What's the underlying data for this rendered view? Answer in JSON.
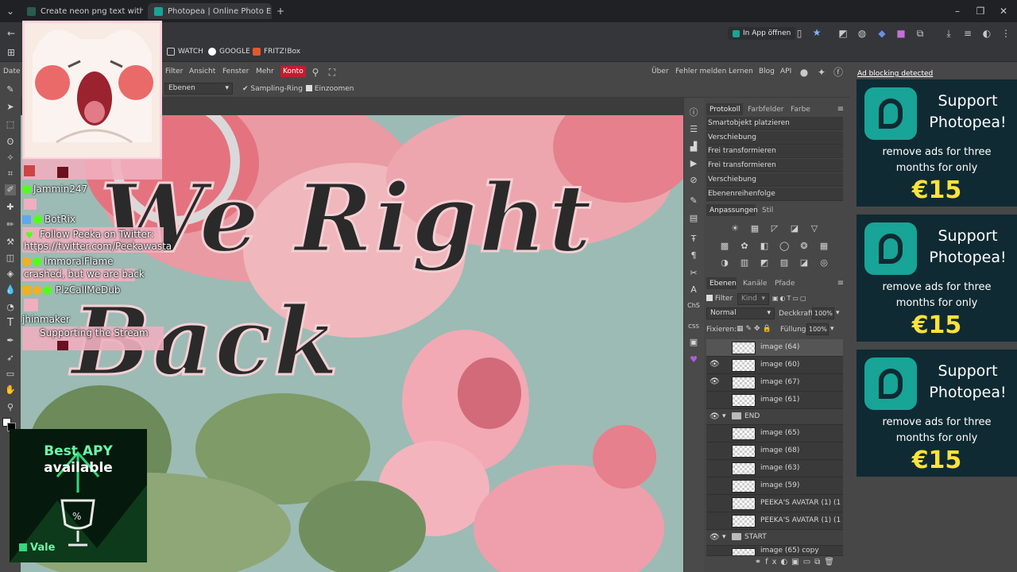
{
  "browser": {
    "tabs": [
      {
        "label": "Create neon png text with a tra",
        "active": false
      },
      {
        "label": "Photopea | Online Photo Editor",
        "active": true
      }
    ],
    "open_in_app": "In App öffnen",
    "bookmarks": [
      "WATCH",
      "GOOGLE",
      "FRITZ!Box"
    ],
    "menu_partial": "Date"
  },
  "photopea": {
    "menu": [
      "Filter",
      "Ansicht",
      "Fenster",
      "Mehr",
      "Konto"
    ],
    "menu_right": [
      "Über",
      "Fehler melden",
      "Lernen",
      "Blog",
      "API"
    ],
    "options": {
      "sample_select": "Ebenen",
      "sampling_ring": "Sampling-Ring",
      "zoom_in": "Einzoomen"
    },
    "history_tabs": [
      "Protokoll",
      "Farbfelder",
      "Farbe"
    ],
    "history": [
      "Smartobjekt platzieren",
      "Verschiebung",
      "Frei transformieren",
      "Frei transformieren",
      "Verschiebung",
      "Ebenenreihenfolge"
    ],
    "adjust_tabs": [
      "Anpassungen",
      "Stil"
    ],
    "layer_tabs": [
      "Ebenen",
      "Kanäle",
      "Pfade"
    ],
    "layers_filter": {
      "label": "Filter",
      "kind": "Kind"
    },
    "blend": "Normal",
    "opacity_label": "Deckkraft:",
    "opacity": "100%",
    "lock_label": "Fixieren:",
    "fill_label": "Füllung:",
    "fill": "100%",
    "ch_label": "ChS",
    "css_label": "CSS",
    "layers": [
      {
        "name": "image (64)",
        "visible": false,
        "folder": false
      },
      {
        "name": "image (60)",
        "visible": true,
        "folder": false
      },
      {
        "name": "image (67)",
        "visible": true,
        "folder": false
      },
      {
        "name": "image (61)",
        "visible": false,
        "folder": false
      },
      {
        "name": "END",
        "visible": true,
        "folder": true
      },
      {
        "name": "image (65)",
        "visible": false,
        "folder": false
      },
      {
        "name": "image (68)",
        "visible": false,
        "folder": false
      },
      {
        "name": "image (63)",
        "visible": false,
        "folder": false
      },
      {
        "name": "image (59)",
        "visible": false,
        "folder": false
      },
      {
        "name": "PEEKA'S AVATAR (1) (1",
        "visible": false,
        "folder": false
      },
      {
        "name": "PEEKA'S AVATAR (1) (1",
        "visible": false,
        "folder": false
      },
      {
        "name": "START",
        "visible": true,
        "folder": true
      },
      {
        "name": "image (65) copy",
        "visible": false,
        "folder": false
      }
    ]
  },
  "canvas": {
    "line1": "We Right",
    "line2": "Back"
  },
  "ads": {
    "notice": "Ad blocking detected",
    "title": "Support Photopea!",
    "subtitle": "remove ads for three months for only",
    "price": "€15"
  },
  "stream": {
    "chat": [
      {
        "text": "Jammin247"
      },
      {
        "text": "BotRix"
      },
      {
        "text": "Follow Peeka on Twitter:"
      },
      {
        "text": "https://twitter.com/Peekawasta"
      },
      {
        "text": "ImmoralFlame"
      },
      {
        "text": "crashed, but we are back"
      },
      {
        "text": "PlzCallMeDub"
      },
      {
        "text": "jhinmaker"
      },
      {
        "text": "Supporting the Stream"
      }
    ],
    "apy_line1": "Best APY",
    "apy_line2": "available",
    "apy_brand": "Vale"
  },
  "colors": {
    "accent": "#18a497",
    "price": "#ffe23a",
    "konto": "#c41c2f",
    "chat_bg": "#efafbf"
  }
}
